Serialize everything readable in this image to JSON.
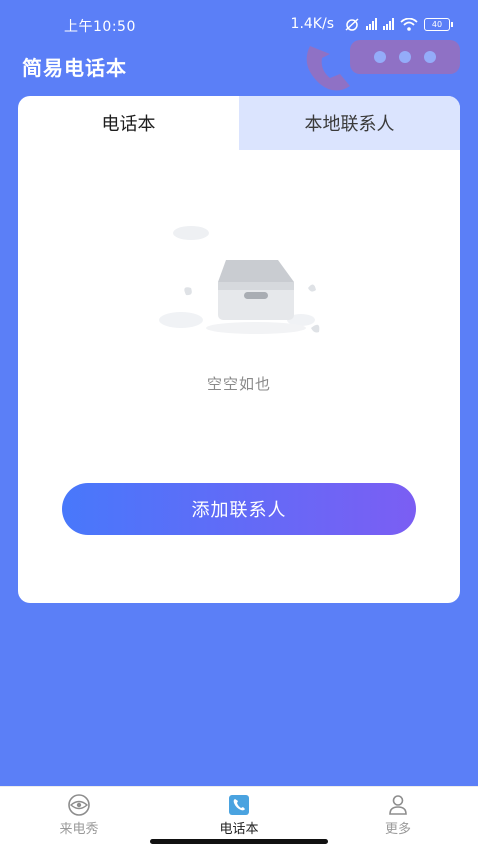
{
  "status_bar": {
    "time": "上午10:50",
    "speed": "1.4K/s",
    "battery": "40"
  },
  "header": {
    "title": "简易电话本"
  },
  "tabs": [
    {
      "label": "电话本",
      "active": true
    },
    {
      "label": "本地联系人",
      "active": false
    }
  ],
  "empty_state": {
    "text": "空空如也",
    "icon": "empty-box-icon"
  },
  "add_button": {
    "label": "添加联系人"
  },
  "bottom_nav": {
    "items": [
      {
        "label": "来电秀",
        "icon": "eye-icon",
        "active": false
      },
      {
        "label": "电话本",
        "icon": "phone-book-icon",
        "active": true
      },
      {
        "label": "更多",
        "icon": "person-icon",
        "active": false
      }
    ]
  },
  "colors": {
    "background": "#5b7ff7",
    "tab_inactive": "#dbe4fe",
    "button_gradient_start": "#4878fb",
    "button_gradient_end": "#7b5ef3",
    "nav_active_icon": "#4aa3e0"
  }
}
